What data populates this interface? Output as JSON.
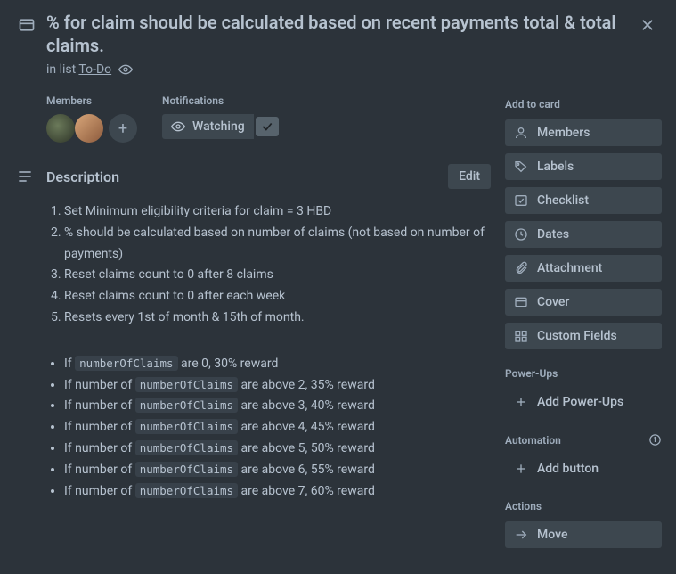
{
  "header": {
    "title": "% for claim should be calculated based on recent payments total & total claims.",
    "in_list_prefix": "in list ",
    "list_name": "To-Do"
  },
  "meta": {
    "members_label": "Members",
    "notifications_label": "Notifications",
    "watching_label": "Watching"
  },
  "description": {
    "heading": "Description",
    "edit_label": "Edit",
    "ordered": [
      "Set Minimum eligibility criteria for claim = 3 HBD",
      "% should be calculated based on number of claims (not based on number of payments)",
      "Reset claims count to 0 after 8 claims",
      "Reset claims count to 0 after each week",
      "Resets every 1st of month & 15th of month."
    ],
    "rules": [
      {
        "pre": "If ",
        "code": "numberOfClaims",
        "post": " are 0, 30% reward"
      },
      {
        "pre": "If number of ",
        "code": "numberOfClaims",
        "post": " are above 2, 35% reward"
      },
      {
        "pre": "If number of ",
        "code": "numberOfClaims",
        "post": " are above 3, 40% reward"
      },
      {
        "pre": "If number of ",
        "code": "numberOfClaims",
        "post": " are above 4, 45% reward"
      },
      {
        "pre": "If number of ",
        "code": "numberOfClaims",
        "post": " are above 5, 50% reward"
      },
      {
        "pre": "If number of ",
        "code": "numberOfClaims",
        "post": " are above 6, 55% reward"
      },
      {
        "pre": "If number of ",
        "code": "numberOfClaims",
        "post": " are above 7, 60% reward"
      }
    ]
  },
  "sidebar": {
    "add_to_card": "Add to card",
    "members": "Members",
    "labels": "Labels",
    "checklist": "Checklist",
    "dates": "Dates",
    "attachment": "Attachment",
    "cover": "Cover",
    "custom_fields": "Custom Fields",
    "powerups_heading": "Power-Ups",
    "add_powerups": "Add Power-Ups",
    "automation_heading": "Automation",
    "add_button": "Add button",
    "actions_heading": "Actions",
    "move": "Move"
  }
}
